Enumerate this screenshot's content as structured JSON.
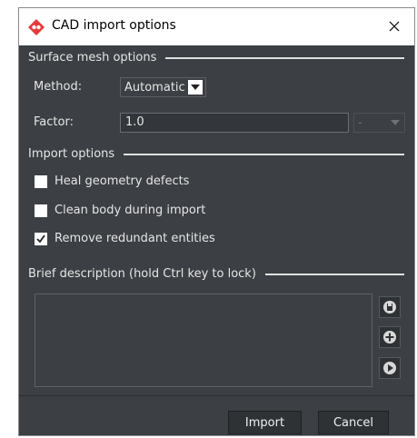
{
  "window": {
    "title": "CAD import options"
  },
  "surface_mesh": {
    "heading": "Surface mesh options",
    "method_label": "Method:",
    "method_value": "Automatic",
    "factor_label": "Factor:",
    "factor_value": "1.0",
    "unit_value": "-"
  },
  "import_options": {
    "heading": "Import options",
    "items": [
      {
        "label": "Heal geometry defects",
        "checked": false
      },
      {
        "label": "Clean body during import",
        "checked": false
      },
      {
        "label": "Remove redundant entities",
        "checked": true
      }
    ]
  },
  "description": {
    "heading": "Brief description (hold Ctrl key to lock)"
  },
  "buttons": {
    "import": "Import",
    "cancel": "Cancel"
  }
}
